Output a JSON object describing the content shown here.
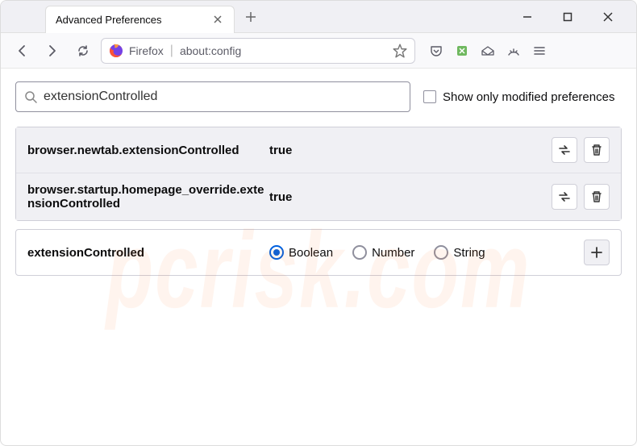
{
  "tab": {
    "title": "Advanced Preferences"
  },
  "urlbar": {
    "brand": "Firefox",
    "url": "about:config"
  },
  "search": {
    "value": "extensionControlled"
  },
  "checkbox_label": "Show only modified preferences",
  "prefs": [
    {
      "name": "browser.newtab.extensionControlled",
      "value": "true"
    },
    {
      "name": "browser.startup.homepage_override.extensionControlled",
      "value": "true"
    }
  ],
  "add": {
    "name": "extensionControlled",
    "types": [
      "Boolean",
      "Number",
      "String"
    ],
    "selected": 0
  },
  "watermark": "pcrisk.com"
}
